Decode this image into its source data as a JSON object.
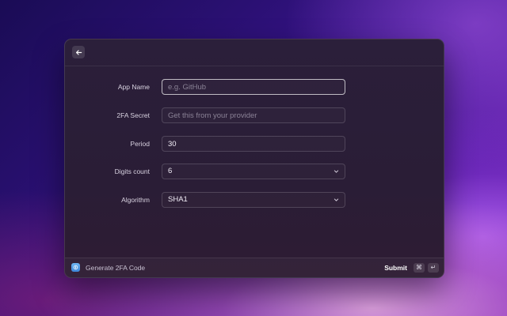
{
  "window": {
    "back_icon": "arrow-left-icon"
  },
  "form": {
    "fields": [
      {
        "label": "App Name",
        "type": "text",
        "value": "",
        "placeholder": "e.g. GitHub"
      },
      {
        "label": "2FA Secret",
        "type": "text",
        "value": "",
        "placeholder": "Get this from your provider"
      },
      {
        "label": "Period",
        "type": "text",
        "value": "30",
        "placeholder": ""
      },
      {
        "label": "Digits count",
        "type": "select",
        "value": "6"
      },
      {
        "label": "Algorithm",
        "type": "select",
        "value": "SHA1"
      }
    ]
  },
  "footer": {
    "icon": "app-icon",
    "title": "Generate 2FA Code",
    "action_label": "Submit",
    "shortcut": [
      "⌘",
      "↵"
    ]
  },
  "colors": {
    "accent": "#3d86d9",
    "window_bg": "#2a1d36"
  }
}
